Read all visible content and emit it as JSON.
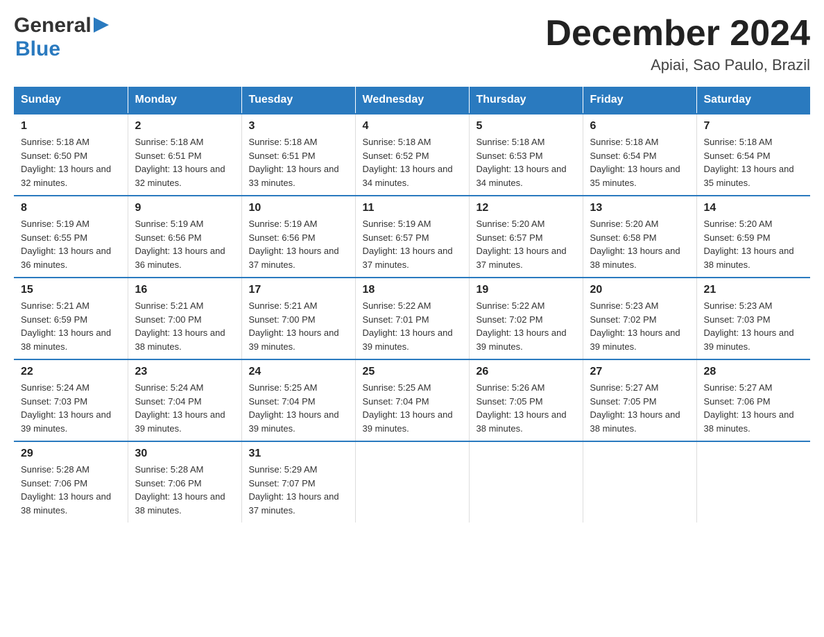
{
  "header": {
    "logo_general": "General",
    "logo_blue": "Blue",
    "month_title": "December 2024",
    "location": "Apiai, Sao Paulo, Brazil"
  },
  "weekdays": [
    "Sunday",
    "Monday",
    "Tuesday",
    "Wednesday",
    "Thursday",
    "Friday",
    "Saturday"
  ],
  "weeks": [
    [
      {
        "day": "1",
        "sunrise": "5:18 AM",
        "sunset": "6:50 PM",
        "daylight": "13 hours and 32 minutes."
      },
      {
        "day": "2",
        "sunrise": "5:18 AM",
        "sunset": "6:51 PM",
        "daylight": "13 hours and 32 minutes."
      },
      {
        "day": "3",
        "sunrise": "5:18 AM",
        "sunset": "6:51 PM",
        "daylight": "13 hours and 33 minutes."
      },
      {
        "day": "4",
        "sunrise": "5:18 AM",
        "sunset": "6:52 PM",
        "daylight": "13 hours and 34 minutes."
      },
      {
        "day": "5",
        "sunrise": "5:18 AM",
        "sunset": "6:53 PM",
        "daylight": "13 hours and 34 minutes."
      },
      {
        "day": "6",
        "sunrise": "5:18 AM",
        "sunset": "6:54 PM",
        "daylight": "13 hours and 35 minutes."
      },
      {
        "day": "7",
        "sunrise": "5:18 AM",
        "sunset": "6:54 PM",
        "daylight": "13 hours and 35 minutes."
      }
    ],
    [
      {
        "day": "8",
        "sunrise": "5:19 AM",
        "sunset": "6:55 PM",
        "daylight": "13 hours and 36 minutes."
      },
      {
        "day": "9",
        "sunrise": "5:19 AM",
        "sunset": "6:56 PM",
        "daylight": "13 hours and 36 minutes."
      },
      {
        "day": "10",
        "sunrise": "5:19 AM",
        "sunset": "6:56 PM",
        "daylight": "13 hours and 37 minutes."
      },
      {
        "day": "11",
        "sunrise": "5:19 AM",
        "sunset": "6:57 PM",
        "daylight": "13 hours and 37 minutes."
      },
      {
        "day": "12",
        "sunrise": "5:20 AM",
        "sunset": "6:57 PM",
        "daylight": "13 hours and 37 minutes."
      },
      {
        "day": "13",
        "sunrise": "5:20 AM",
        "sunset": "6:58 PM",
        "daylight": "13 hours and 38 minutes."
      },
      {
        "day": "14",
        "sunrise": "5:20 AM",
        "sunset": "6:59 PM",
        "daylight": "13 hours and 38 minutes."
      }
    ],
    [
      {
        "day": "15",
        "sunrise": "5:21 AM",
        "sunset": "6:59 PM",
        "daylight": "13 hours and 38 minutes."
      },
      {
        "day": "16",
        "sunrise": "5:21 AM",
        "sunset": "7:00 PM",
        "daylight": "13 hours and 38 minutes."
      },
      {
        "day": "17",
        "sunrise": "5:21 AM",
        "sunset": "7:00 PM",
        "daylight": "13 hours and 39 minutes."
      },
      {
        "day": "18",
        "sunrise": "5:22 AM",
        "sunset": "7:01 PM",
        "daylight": "13 hours and 39 minutes."
      },
      {
        "day": "19",
        "sunrise": "5:22 AM",
        "sunset": "7:02 PM",
        "daylight": "13 hours and 39 minutes."
      },
      {
        "day": "20",
        "sunrise": "5:23 AM",
        "sunset": "7:02 PM",
        "daylight": "13 hours and 39 minutes."
      },
      {
        "day": "21",
        "sunrise": "5:23 AM",
        "sunset": "7:03 PM",
        "daylight": "13 hours and 39 minutes."
      }
    ],
    [
      {
        "day": "22",
        "sunrise": "5:24 AM",
        "sunset": "7:03 PM",
        "daylight": "13 hours and 39 minutes."
      },
      {
        "day": "23",
        "sunrise": "5:24 AM",
        "sunset": "7:04 PM",
        "daylight": "13 hours and 39 minutes."
      },
      {
        "day": "24",
        "sunrise": "5:25 AM",
        "sunset": "7:04 PM",
        "daylight": "13 hours and 39 minutes."
      },
      {
        "day": "25",
        "sunrise": "5:25 AM",
        "sunset": "7:04 PM",
        "daylight": "13 hours and 39 minutes."
      },
      {
        "day": "26",
        "sunrise": "5:26 AM",
        "sunset": "7:05 PM",
        "daylight": "13 hours and 38 minutes."
      },
      {
        "day": "27",
        "sunrise": "5:27 AM",
        "sunset": "7:05 PM",
        "daylight": "13 hours and 38 minutes."
      },
      {
        "day": "28",
        "sunrise": "5:27 AM",
        "sunset": "7:06 PM",
        "daylight": "13 hours and 38 minutes."
      }
    ],
    [
      {
        "day": "29",
        "sunrise": "5:28 AM",
        "sunset": "7:06 PM",
        "daylight": "13 hours and 38 minutes."
      },
      {
        "day": "30",
        "sunrise": "5:28 AM",
        "sunset": "7:06 PM",
        "daylight": "13 hours and 38 minutes."
      },
      {
        "day": "31",
        "sunrise": "5:29 AM",
        "sunset": "7:07 PM",
        "daylight": "13 hours and 37 minutes."
      },
      null,
      null,
      null,
      null
    ]
  ]
}
